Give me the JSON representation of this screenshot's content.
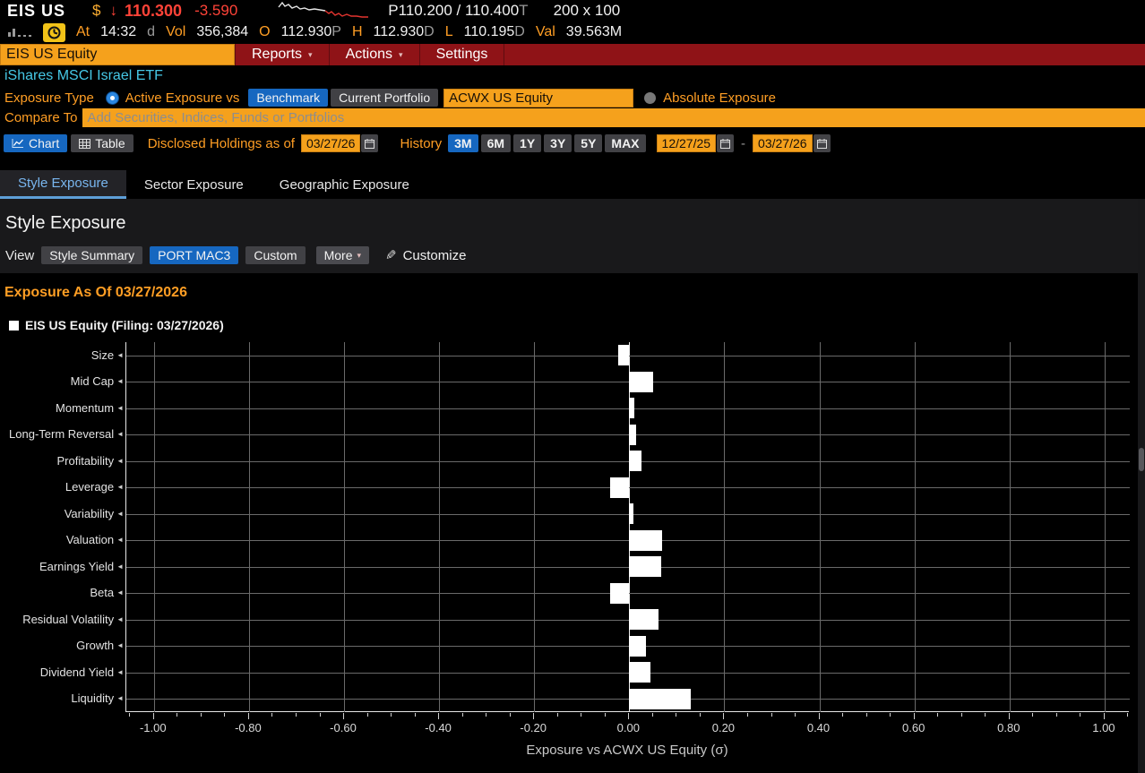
{
  "quote": {
    "ticker": "EIS US",
    "currency": "$",
    "last": "110.300",
    "change": "-3.590",
    "bid_ask": "P110.200 / 110.400",
    "bid_ask_suffix": "T",
    "lot": "200 x 100",
    "at_label": "At",
    "time": "14:32",
    "session": "d",
    "vol_label": "Vol",
    "volume": "356,384",
    "open_label": "O",
    "open": "112.930",
    "open_suffix": "P",
    "high_label": "H",
    "high": "112.930",
    "high_suffix": "D",
    "low_label": "L",
    "low": "110.195",
    "low_suffix": "D",
    "val_label": "Val",
    "val": "39.563M"
  },
  "menu": {
    "security_input": "EIS US Equity",
    "items": [
      "Reports",
      "Actions",
      "Settings"
    ]
  },
  "security_name": "iShares MSCI Israel ETF",
  "controls": {
    "exposure_type_label": "Exposure Type",
    "active_exposure_label": "Active Exposure vs",
    "benchmark_button": "Benchmark",
    "current_portfolio_button": "Current Portfolio",
    "benchmark_input": "ACWX US Equity",
    "absolute_exposure_label": "Absolute Exposure",
    "compare_to_label": "Compare To",
    "compare_placeholder": "Add Securities, Indices, Funds or Portfolios",
    "chart_button": "Chart",
    "table_button": "Table",
    "disclosed_label": "Disclosed Holdings as of",
    "disclosed_date": "03/27/26",
    "history_label": "History",
    "history_ranges": [
      "3M",
      "6M",
      "1Y",
      "3Y",
      "5Y",
      "MAX"
    ],
    "history_selected": "3M",
    "date_from": "12/27/25",
    "date_separator": "-",
    "date_to": "03/27/26"
  },
  "tabs": [
    "Style Exposure",
    "Sector Exposure",
    "Geographic Exposure"
  ],
  "section": {
    "heading": "Style Exposure",
    "view_label": "View",
    "view_buttons": [
      "Style Summary",
      "PORT MAC3",
      "Custom"
    ],
    "view_selected": "PORT MAC3",
    "more_button": "More",
    "customize_button": "Customize"
  },
  "exposure_title": "Exposure As Of 03/27/2026",
  "legend_label": "EIS US Equity (Filing: 03/27/2026)",
  "chart_data": {
    "type": "bar",
    "orientation": "horizontal",
    "title": "Exposure As Of 03/27/2026",
    "series_name": "EIS US Equity (Filing: 03/27/2026)",
    "categories": [
      "Size",
      "Mid Cap",
      "Momentum",
      "Long-Term Reversal",
      "Profitability",
      "Leverage",
      "Variability",
      "Valuation",
      "Earnings Yield",
      "Beta",
      "Residual Volatility",
      "Growth",
      "Dividend Yield",
      "Liquidity"
    ],
    "values": [
      -0.023,
      0.051,
      0.011,
      0.014,
      0.025,
      -0.04,
      0.009,
      0.07,
      0.067,
      -0.041,
      0.061,
      0.035,
      0.044,
      0.13
    ],
    "xlabel": "Exposure vs ACWX US Equity (σ)",
    "xlim": [
      -1.058,
      1.053
    ],
    "xticks": [
      -1.0,
      -0.8,
      -0.6,
      -0.4,
      -0.2,
      0.0,
      0.2,
      0.4,
      0.6,
      0.8,
      1.0
    ],
    "minor_tick_step": 0.05,
    "bar_color": "#ffffff",
    "grid": true,
    "legend_position": "top-left"
  },
  "colors": {
    "amber_text": "#ff9e24",
    "amber_input_bg": "#f5a11c",
    "price_red": "#ff4338",
    "menu_red": "#8f1317",
    "selected_blue": "#1667c0",
    "security_cyan": "#46c8e6",
    "bar_white": "#ffffff",
    "grid_gray": "#6a6a6a",
    "panel_gray": "#19191b"
  }
}
